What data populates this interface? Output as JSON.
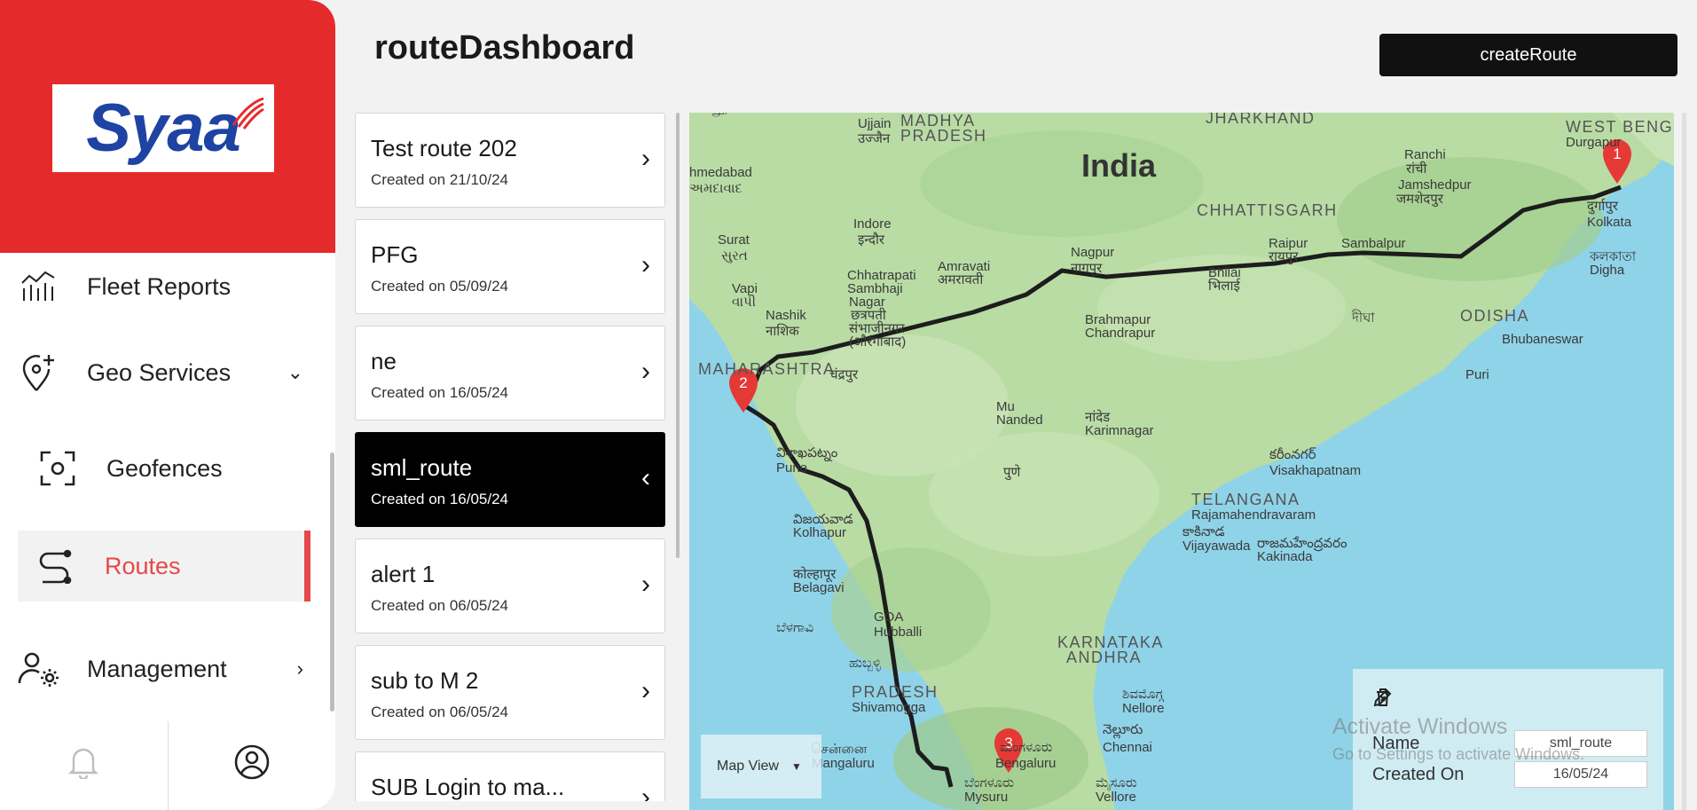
{
  "brand": {
    "logo_text": "Syaa"
  },
  "sidebar": {
    "items": [
      {
        "label": "Fleet Reports"
      },
      {
        "label": "Geo Services"
      },
      {
        "label": "Geofences"
      },
      {
        "label": "Routes"
      },
      {
        "label": "Management"
      }
    ],
    "active": "Routes"
  },
  "header": {
    "title": "routeDashboard",
    "create_label": "createRoute"
  },
  "routes": [
    {
      "name": "Test route 202",
      "date": "Created on 21/10/24",
      "selected": false
    },
    {
      "name": "PFG",
      "date": "Created on 05/09/24",
      "selected": false
    },
    {
      "name": "ne",
      "date": "Created on 16/05/24",
      "selected": false
    },
    {
      "name": "sml_route",
      "date": "Created on 16/05/24",
      "selected": true
    },
    {
      "name": "alert 1",
      "date": "Created on 06/05/24",
      "selected": false
    },
    {
      "name": "sub to M 2",
      "date": "Created on 06/05/24",
      "selected": false
    },
    {
      "name": "SUB Login to ma...",
      "date": "",
      "selected": false
    }
  ],
  "map": {
    "view_label": "Map View",
    "country": "India",
    "places": [
      "Ujjain",
      "उज्जैन",
      "MADHYA",
      "PRADESH",
      "hmedabad",
      "અમદાવાદ",
      "Indore",
      "इन्दौर",
      "Surat",
      "સુરત",
      "Vapi",
      "વાપી",
      "Nashik",
      "नाशिक",
      "Chhatrapati",
      "Sambhaji",
      "Nagar",
      "छत्रपती",
      "संभाजीनगर",
      "(औरंगाबाद)",
      "Amravati",
      "अमरावती",
      "Nagpur",
      "नागपूर",
      "CHHATTISGARH",
      "Raipur",
      "रायपुर",
      "Bhilai",
      "भिलाई",
      "Sambalpur",
      "JHARKHAND",
      "Ranchi",
      "रांची",
      "Jamshedpur",
      "जमशेदपुर",
      "WEST BENG",
      "Durgapur",
      "दुर्गापुर",
      "Kolkata",
      "কলকাতা",
      "Digha",
      "দীঘা",
      "ODISHA",
      "Bhubaneswar",
      "Puri",
      "Brahmapur",
      "Chandrapur",
      "चंद्रपुर",
      "MAHARASHTRA",
      "Mu",
      "Nanded",
      "नांदेड",
      "Karimnagar",
      "కరీంనగర్",
      "Visakhapatnam",
      "విశాఖపట్నం",
      "Pune",
      "पुणे",
      "TELANGANA",
      "Rajamahendravaram",
      "రాజమహేంద్రవరం",
      "Kakinada",
      "కాకినాడ",
      "Vijayawada",
      "విజయవాడ",
      "Kolhapur",
      "कोल्हापूर",
      "Belagavi",
      "ಬೆಳಗಾವಿ",
      "GOA",
      "Hubballi",
      "ಹುಬ್ಬಳ್ಳಿ",
      "KARNATAKA",
      "ANDHRA",
      "PRADESH",
      "Shivamogga",
      "ಶಿವಮೊಗ್ಗ",
      "Nellore",
      "నెల్లూరు",
      "Chennai",
      "சென்னை",
      "Mangaluru",
      "ಮಂಗಳೂರು",
      "Bengaluru",
      "ಬೆಂಗಳೂರು",
      "Mysuru",
      "ಮೈಸೂರು",
      "Vellore",
      "வேலூர்"
    ],
    "markers": [
      "1",
      "2",
      "3"
    ]
  },
  "info": {
    "name_label": "Name",
    "name_value": "sml_route",
    "created_label": "Created On",
    "created_value": "16/05/24"
  },
  "watermark": {
    "line1": "Activate Windows",
    "line2": "Go to Settings to activate Windows."
  },
  "colors": {
    "brand_red": "#e52a2c",
    "accent": "#e5484a",
    "dark": "#111111"
  }
}
